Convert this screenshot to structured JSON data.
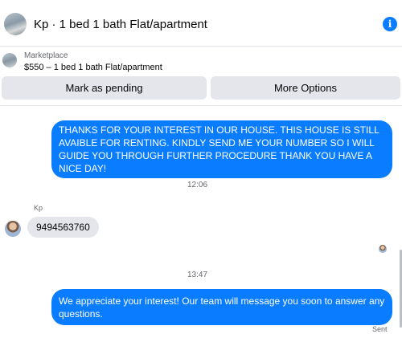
{
  "header": {
    "title": "Kp · 1 bed 1 bath Flat/apartment",
    "avatar_icon": "listing-photo-avatar",
    "info_icon": "info-icon",
    "info_glyph": "i"
  },
  "marketplace": {
    "label": "Marketplace",
    "listing": "$550 – 1 bed 1 bath Flat/apartment"
  },
  "actions": {
    "pending_label": "Mark as pending",
    "more_label": "More Options"
  },
  "conversation": {
    "messages": [
      {
        "from": "me",
        "text": "THANKS FOR YOUR INTEREST IN OUR HOUSE. THIS HOUSE IS STILL AVAIBLE FOR RENTING. KINDLY SEND ME YOUR NUMBER SO I WILL GUIDE YOU THROUGH FURTHER PROCEDURE THANK YOU HAVE A NICE DAY!"
      },
      {
        "timestamp": "12:06"
      },
      {
        "from": "Kp",
        "sender_name": "Kp",
        "text": "9494563760"
      },
      {
        "timestamp": "13:47"
      },
      {
        "from": "me",
        "text": "We appreciate your interest! Our team will message you soon to answer any questions.",
        "status": "Sent"
      }
    ]
  },
  "colors": {
    "outgoing_bubble": "#0a7cff",
    "incoming_bubble": "#e4e6eb",
    "button_bg": "#e4e6eb",
    "accent": "#0a7cff"
  }
}
